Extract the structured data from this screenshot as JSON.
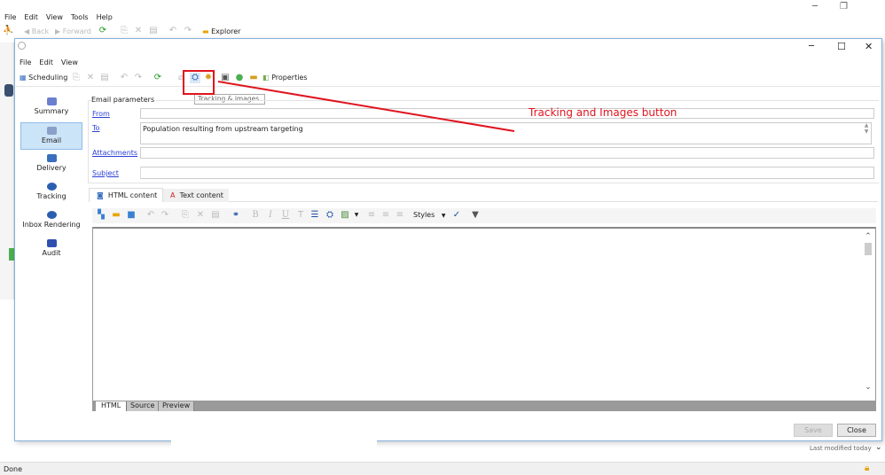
{
  "app": {
    "menu": [
      "File",
      "Edit",
      "View",
      "Tools",
      "Help"
    ],
    "toolbar": {
      "back": "Back",
      "forward": "Forward",
      "explorer": "Explorer"
    },
    "status": "Done",
    "last_modified": "Last modified today"
  },
  "dialog": {
    "menu": [
      "File",
      "Edit",
      "View"
    ],
    "toolbar": {
      "scheduling": "Scheduling",
      "properties": "Properties",
      "tooltip": "Tracking & images"
    },
    "nav": [
      {
        "label": "Summary",
        "color": "#6a7fd0"
      },
      {
        "label": "Email",
        "color": "#8aa0c8",
        "selected": true
      },
      {
        "label": "Delivery",
        "color": "#3a6fc0"
      },
      {
        "label": "Tracking",
        "color": "#2a5fb0"
      },
      {
        "label": "Inbox Rendering",
        "color": "#2a5fb0"
      },
      {
        "label": "Audit",
        "color": "#3050b0"
      }
    ],
    "params": {
      "title": "Email parameters",
      "from_label": "From",
      "from_value": "",
      "to_label": "To",
      "to_value": "Population resulting from upstream targeting",
      "attachments_label": "Attachments",
      "attachments_value": "",
      "subject_label": "Subject",
      "subject_value": ""
    },
    "content_tabs": [
      "HTML content",
      "Text content"
    ],
    "editor": {
      "styles": "Styles",
      "bold": "B",
      "italic": "I",
      "underline": "U"
    },
    "view_tabs": [
      "HTML",
      "Source",
      "Preview"
    ],
    "save": "Save",
    "close": "Close"
  },
  "annotation": {
    "text": "Tracking and Images button",
    "color": "#e0141e"
  }
}
